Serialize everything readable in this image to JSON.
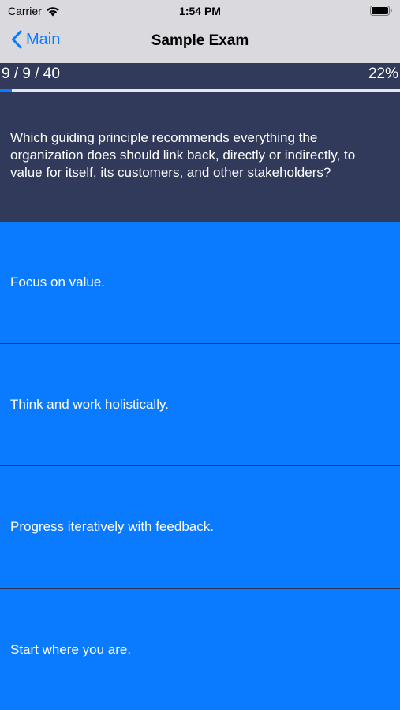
{
  "status_bar": {
    "carrier": "Carrier",
    "time": "1:54 PM"
  },
  "nav": {
    "back_label": "Main",
    "title": "Sample Exam"
  },
  "progress": {
    "count_label": "9 / 9 / 40",
    "percent_label": "22%",
    "fraction": 0.03
  },
  "question": {
    "text": "Which guiding principle recommends everything the organization does should link back, directly or indirectly, to value for itself, its customers, and other stakeholders?"
  },
  "answers": [
    {
      "label": "Focus on value."
    },
    {
      "label": "Think and work holistically."
    },
    {
      "label": "Progress iteratively with feedback."
    },
    {
      "label": "Start where you are."
    }
  ],
  "colors": {
    "accent": "#0a7aff",
    "header_dark": "#313a5a"
  }
}
